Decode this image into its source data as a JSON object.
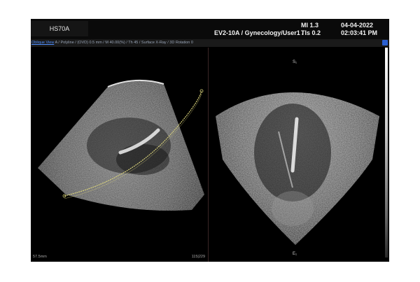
{
  "header": {
    "model": "HS70A",
    "preset": "EV2-10A / Gynecology/User1 /",
    "mi": "MI  1.3",
    "tis": "TIs 0.2",
    "date": "04-04-2022",
    "time": "02:03:41 PM"
  },
  "infobar": {
    "oblique_label": "Oblique View",
    "params": " A / Polyline / (OVD) 0.5 mm / M 40.00(%) / Th 45 / Surface X-Ray / 3D Rotation 0"
  },
  "left_pane": {
    "depth": "57.5mm",
    "frame": "115|229"
  },
  "right_pane": {
    "orient_top": "S₁",
    "orient_bottom": "E₁"
  },
  "colors": {
    "oblique_link": "#4f8fff",
    "scroll_button": "#2a5fd1",
    "polyline": "#d9d27a"
  }
}
